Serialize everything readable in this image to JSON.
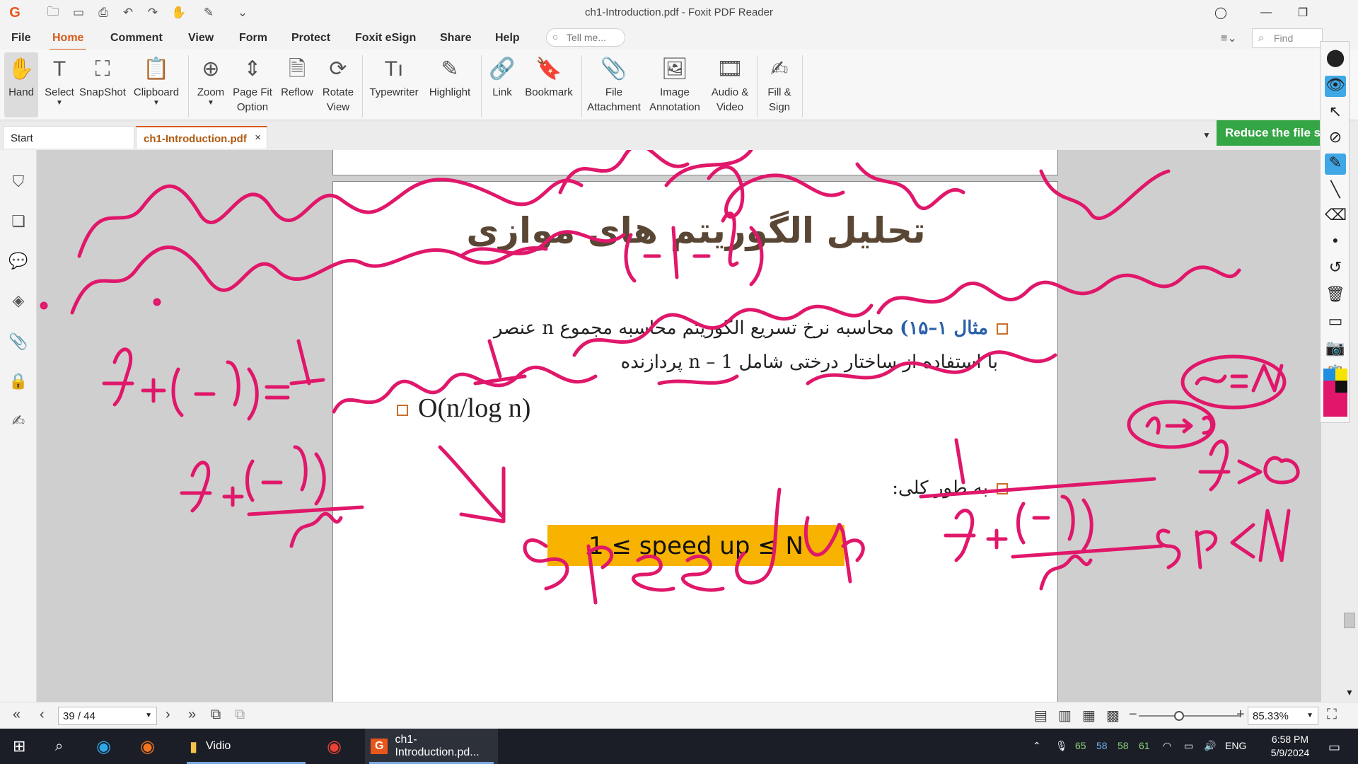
{
  "window": {
    "title": "ch1-Introduction.pdf - Foxit PDF Reader"
  },
  "menu": {
    "items": [
      "File",
      "Home",
      "Comment",
      "View",
      "Form",
      "Protect",
      "Foxit eSign",
      "Share",
      "Help"
    ],
    "active": "Home",
    "tell_me_placeholder": "Tell me...",
    "find_placeholder": "Find"
  },
  "ribbon": {
    "tools": [
      {
        "label": "Hand",
        "icon": "hand-icon"
      },
      {
        "label": "Select",
        "icon": "select-text-icon"
      },
      {
        "label": "SnapShot",
        "icon": "snapshot-icon"
      },
      {
        "label": "Clipboard",
        "icon": "clipboard-icon"
      },
      {
        "label": "Zoom",
        "icon": "zoom-icon"
      },
      {
        "label": "Page Fit Option",
        "icon": "page-fit-icon"
      },
      {
        "label": "Reflow",
        "icon": "reflow-icon"
      },
      {
        "label": "Rotate View",
        "icon": "rotate-view-icon"
      },
      {
        "label": "Typewriter",
        "icon": "typewriter-icon"
      },
      {
        "label": "Highlight",
        "icon": "highlight-icon"
      },
      {
        "label": "Link",
        "icon": "link-icon"
      },
      {
        "label": "Bookmark",
        "icon": "bookmark-icon"
      },
      {
        "label": "File Attachment",
        "icon": "file-attachment-icon"
      },
      {
        "label": "Image Annotation",
        "icon": "image-annotation-icon"
      },
      {
        "label": "Audio & Video",
        "icon": "audio-video-icon"
      },
      {
        "label": "Fill & Sign",
        "icon": "fill-sign-icon"
      }
    ]
  },
  "tabs": {
    "start": "Start",
    "document": "ch1-Introduction.pdf",
    "close": "×"
  },
  "banner": {
    "reduce_label": "Reduce the file size"
  },
  "slide": {
    "title": "تحلیل الگوریتم های موازی",
    "example_label": "مثال ۱–۱۵)",
    "example_line1": "محاسبه نرخ تسریع الگوریتم محاسبه مجموع n عنصر",
    "example_line2": "با استفاده از ساختار درختی شامل n – 1 پردازنده",
    "complexity": "O(n/log n)",
    "general_label": "به طور کلی:",
    "speedup_bound": "1 ≤ speed up ≤ N"
  },
  "status": {
    "page_indicator": "39 / 44",
    "zoom": "85.33%"
  },
  "taskbar": {
    "vidio_label": "Vidio",
    "foxit_label": "ch1-Introduction.pd...",
    "tray_numbers": [
      "65",
      "58",
      "58",
      "61"
    ],
    "language": "ENG",
    "time": "6:58 PM",
    "date": "5/9/2024"
  },
  "colors": {
    "accent": "#d85a1a",
    "ink": "#e0176a",
    "banner": "#35a645",
    "speedbox": "#f8b300",
    "taskbar": "#1b1e26"
  }
}
